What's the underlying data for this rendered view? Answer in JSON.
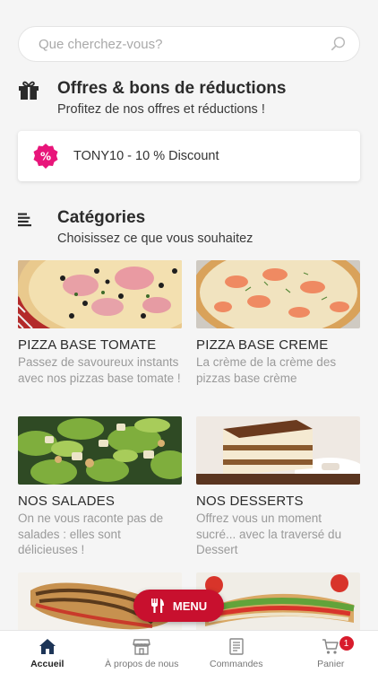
{
  "search": {
    "placeholder": "Que cherchez-vous?"
  },
  "offers": {
    "title": "Offres & bons de réductions",
    "subtitle": "Profitez de nos offres et réductions !",
    "items": [
      {
        "text": "TONY10 - 10 % Discount",
        "badge_color": "#e8157a"
      }
    ]
  },
  "categories": {
    "title": "Catégories",
    "subtitle": "Choisissez ce que vous souhaitez",
    "items": [
      {
        "name": "PIZZA BASE TOMATE",
        "desc": "Passez de savoureux instants avec nos pizzas base tomate !"
      },
      {
        "name": "PIZZA BASE CREME",
        "desc": "La crème de la crème des pizzas base crème"
      },
      {
        "name": "NOS SALADES",
        "desc": "On ne vous raconte pas de salades : elles sont délicieuses !"
      },
      {
        "name": "NOS DESSERTS",
        "desc": "Offrez vous un moment sucré... avec la traversé du Dessert"
      },
      {
        "name": "",
        "desc": ""
      },
      {
        "name": "",
        "desc": ""
      }
    ]
  },
  "menu_button": {
    "label": "MENU",
    "color": "#c8102e"
  },
  "tabbar": {
    "items": [
      {
        "label": "Accueil",
        "icon": "home-icon",
        "active": true
      },
      {
        "label": "À propos de nous",
        "icon": "store-icon"
      },
      {
        "label": "Commandes",
        "icon": "receipt-icon"
      },
      {
        "label": "Panier",
        "icon": "cart-icon",
        "badge": "1"
      }
    ]
  }
}
